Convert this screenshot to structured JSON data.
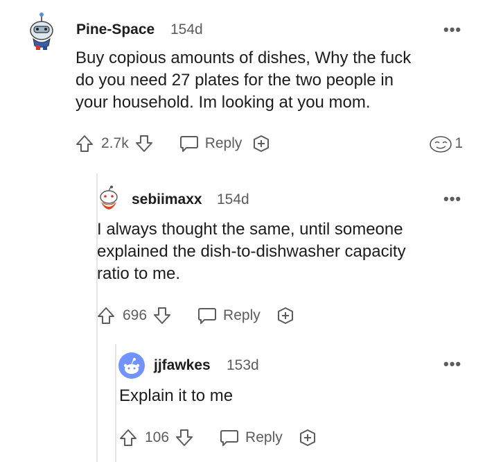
{
  "comments": [
    {
      "username": "Pine-Space",
      "age": "154d",
      "text_lines": [
        "Buy copious amounts of dishes, Why the fuck",
        "do you need 27 plates for the two people in",
        "your household. Im looking at you mom."
      ],
      "votes": "2.7k",
      "reply_label": "Reply",
      "award_count": "1",
      "avatar_icon": "snoo-robot-avatar"
    },
    {
      "username": "sebiimaxx",
      "age": "154d",
      "text_lines": [
        "I always thought the same, until someone",
        "explained the dish-to-dishwasher capacity",
        "ratio to me."
      ],
      "votes": "696",
      "reply_label": "Reply",
      "avatar_icon": "snoo-red-avatar"
    },
    {
      "username": "jjfawkes",
      "age": "153d",
      "text_lines": [
        "Explain it to me"
      ],
      "votes": "106",
      "reply_label": "Reply",
      "avatar_icon": "default-snoo-avatar"
    }
  ],
  "menu_glyph": "•••",
  "colors": {
    "text": "#1c1c1c",
    "muted": "#5c5c5c",
    "thread_line": "#e5e5e5",
    "avatar_blue": "#7193ff"
  }
}
